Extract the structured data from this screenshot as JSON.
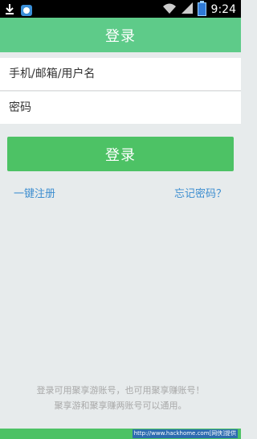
{
  "status_bar": {
    "time": "9:24",
    "icons": [
      "download-icon",
      "app-notification-icon",
      "wifi-icon",
      "signal-icon",
      "battery-icon"
    ]
  },
  "header": {
    "title": "登录"
  },
  "form": {
    "username_placeholder": "手机/邮箱/用户名",
    "password_placeholder": "密码",
    "login_label": "登录"
  },
  "links": {
    "register": "一键注册",
    "forgot_password": "忘记密码？"
  },
  "footer": {
    "line1": "登录可用聚享游账号，也可用聚享赚账号！",
    "line2": "聚享游和聚享赚两账号可以通用。"
  },
  "watermark": "http://www.hackhome.com[网侠]提供",
  "colors": {
    "header": "#5ecb89",
    "button": "#4dc265",
    "link": "#3d8ed0",
    "background": "#e7ebec"
  }
}
